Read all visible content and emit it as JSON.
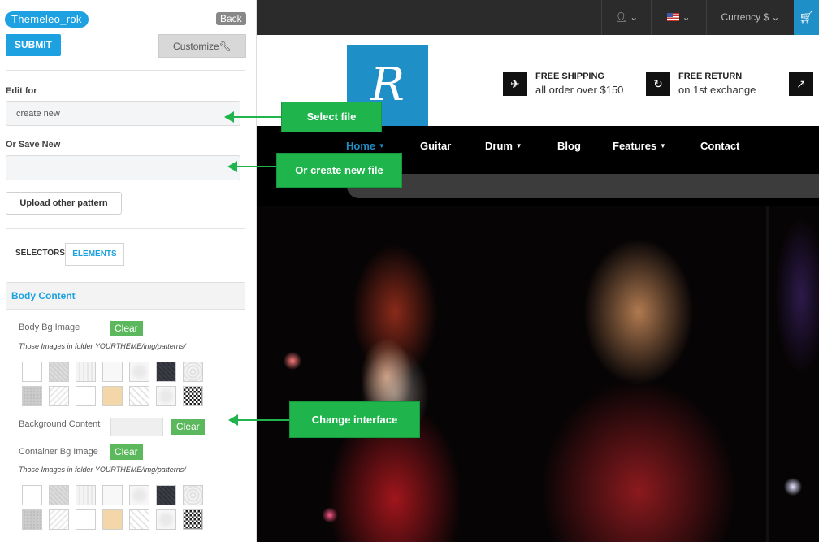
{
  "panel": {
    "theme_name": "Themeleo_rok",
    "back_label": "Back",
    "submit_label": "SUBMIT",
    "customize_label": "Customize",
    "edit_for_label": "Edit for",
    "edit_for_value": "create new",
    "save_new_label": "Or Save New",
    "save_new_value": "",
    "upload_label": "Upload other pattern",
    "tabs": {
      "selectors": "SELECTORS",
      "elements": "ELEMENTS"
    },
    "section_title": "Body Content",
    "body_bg_image_label": "Body Bg Image",
    "background_content_label": "Background Content",
    "container_bg_image_label": "Container Bg Image",
    "clear_label": "Clear",
    "patterns_note": "Those Images in folder YOURTHEME/img/patterns/",
    "patterns": [
      "p-plain",
      "p-grey",
      "p-wood",
      "p-light",
      "p-swirl",
      "p-dark",
      "p-lace",
      "p-dots",
      "p-diag",
      "p-plain",
      "p-beige",
      "p-stripe",
      "p-swirl",
      "p-check"
    ]
  },
  "site": {
    "currency_label": "Currency $",
    "logo_letter": "R",
    "features": [
      {
        "icon": "plane-icon",
        "title": "FREE SHIPPING",
        "subtitle": "all order over $150"
      },
      {
        "icon": "return-icon",
        "title": "FREE RETURN",
        "subtitle": "on 1st exchange"
      }
    ],
    "nav": [
      {
        "label": "Home",
        "dropdown": true,
        "active": true
      },
      {
        "label": "Guitar",
        "dropdown": false
      },
      {
        "label": "Drum",
        "dropdown": true
      },
      {
        "label": "Blog",
        "dropdown": false
      },
      {
        "label": "Features",
        "dropdown": true
      },
      {
        "label": "Contact",
        "dropdown": false
      }
    ]
  },
  "annotations": {
    "select_file": "Select file",
    "create_new_file": "Or create new file",
    "change_interface": "Change interface"
  },
  "colors": {
    "accent": "#1da1e0",
    "annotation": "#1fb54c",
    "clear": "#5cb85c",
    "brand": "#1f8fc7"
  }
}
